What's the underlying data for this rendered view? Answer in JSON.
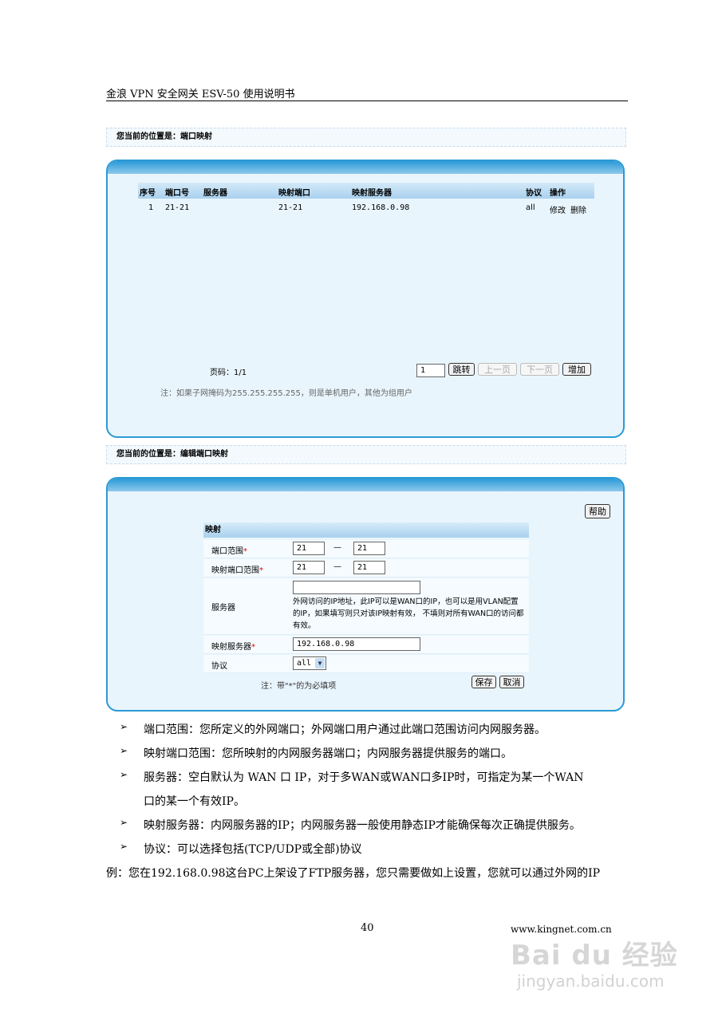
{
  "doc": {
    "header": "金浪 VPN 安全网关 ESV-50 使用说明书",
    "page_number": "40",
    "site": "www.kingnet.com.cn"
  },
  "list_panel": {
    "breadcrumb": "您当前的位置是：端口映射",
    "columns": [
      "序号",
      "端口号",
      "服务器",
      "映射端口",
      "映射服务器",
      "协议",
      "操作"
    ],
    "rows": [
      {
        "index": "1",
        "port": "21-21",
        "server": "",
        "map_port": "21-21",
        "map_server": "192.168.0.98",
        "protocol": "all",
        "edit": "修改",
        "delete": "删除"
      }
    ],
    "pager_label": "页码：1/1",
    "page_input": "1",
    "jump_label": "跳转",
    "prev_label": "上一页",
    "next_label": "下一页",
    "add_label": "增加",
    "note": "注：如果子网掩码为255.255.255.255，则是单机用户，其他为组用户"
  },
  "edit_panel": {
    "breadcrumb": "您当前的位置是：编辑端口映射",
    "help_label": "帮助",
    "section_title": "映射",
    "port_range": {
      "label": "端口范围",
      "from": "21",
      "dash": "—",
      "to": "21"
    },
    "map_port_range": {
      "label": "映射端口范围",
      "from": "21",
      "dash": "—",
      "to": "21"
    },
    "server": {
      "label": "服务器",
      "value": "",
      "hint": "外网访问的IP地址，此IP可以是WAN口的IP，也可以是用VLAN配置的IP，如果填写则只对该IP映射有效， 不填则对所有WAN口的访问都有效。"
    },
    "map_server": {
      "label": "映射服务器",
      "value": "192.168.0.98"
    },
    "protocol": {
      "label": "协议",
      "value": "all"
    },
    "required_note": "注：带\"*\"的为必填项",
    "save_label": "保存",
    "cancel_label": "取消"
  },
  "bullets": [
    "端口范围：您所定义的外网端口；外网端口用户通过此端口范围访问内网服务器。",
    "映射端口范围：您所映射的内网服务器端口；内网服务器提供服务的端口。",
    "服务器：空白默认为 WAN 口 IP，对于多WAN或WAN口多IP时，可指定为某一个WAN",
    "口的某一个有效IP。",
    "映射服务器：内网服务器的IP；内网服务器一般使用静态IP才能确保每次正确提供服务。",
    "协议：可以选择包括(TCP/UDP或全部)协议"
  ],
  "example": "例：您在192.168.0.98这台PC上架设了FTP服务器，您只需要做如上设置，您就可以通过外网的IP",
  "watermark": {
    "brand": "Bai du 经验",
    "url": "jingyan.baidu.com"
  }
}
